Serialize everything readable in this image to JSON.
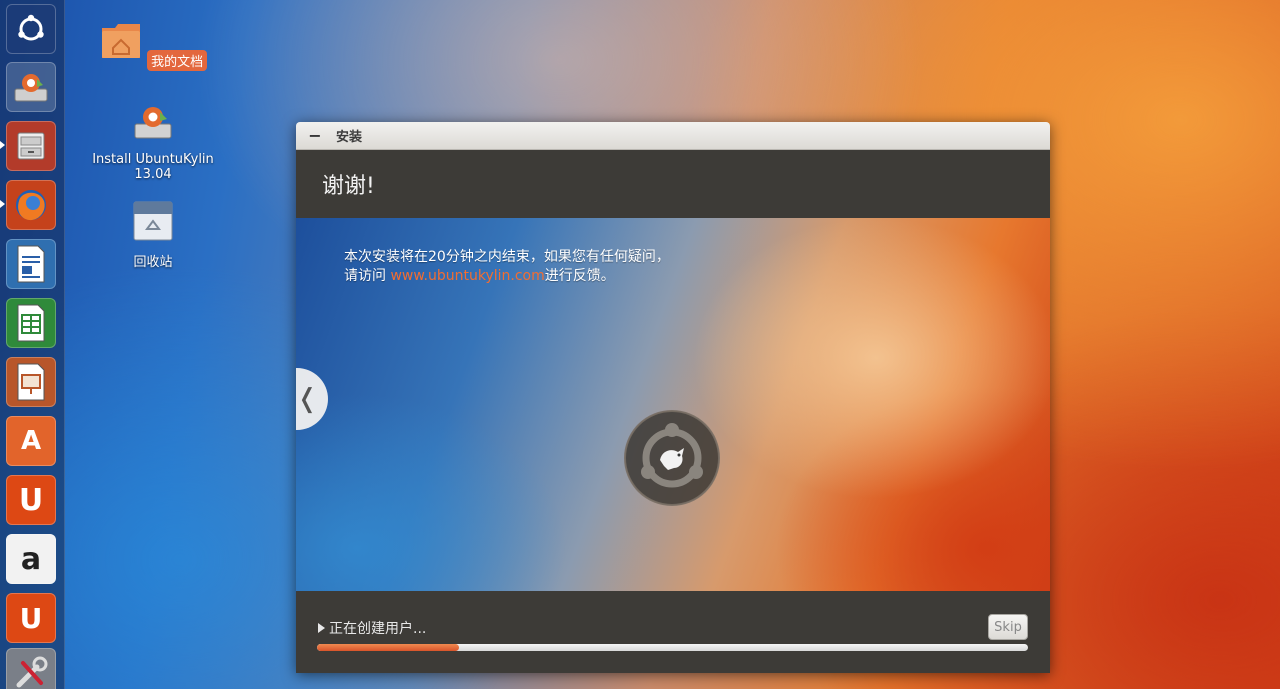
{
  "desktop": {
    "icons": [
      {
        "label": "我的文档",
        "icon": "folder-home-icon",
        "selected": true
      },
      {
        "label_line1": "Install UbuntuKylin",
        "label_line2": "13.04",
        "icon": "installer-icon"
      },
      {
        "label": "回收站",
        "icon": "trash-icon"
      }
    ]
  },
  "launcher": {
    "items": [
      {
        "name": "dash-home",
        "icon": "ubuntu-logo-icon"
      },
      {
        "name": "installer",
        "icon": "installer-icon"
      },
      {
        "name": "file-manager",
        "icon": "file-cabinet-icon",
        "running": true
      },
      {
        "name": "firefox",
        "icon": "firefox-icon",
        "running": true
      },
      {
        "name": "writer",
        "icon": "document-writer-icon"
      },
      {
        "name": "calc",
        "icon": "spreadsheet-icon"
      },
      {
        "name": "impress",
        "icon": "presentation-icon"
      },
      {
        "name": "software-center",
        "icon": "software-center-icon",
        "glyph": "A"
      },
      {
        "name": "ubuntu-one",
        "icon": "ubuntu-one-icon",
        "glyph": "U"
      },
      {
        "name": "amazon",
        "icon": "amazon-icon",
        "glyph": "a"
      },
      {
        "name": "ubuntu-one-music",
        "icon": "ubuntu-one-music-icon",
        "glyph": "U"
      },
      {
        "name": "system-settings",
        "icon": "settings-tools-icon"
      }
    ]
  },
  "installer_window": {
    "title": "安装",
    "heading": "谢谢!",
    "slide_text_before": "本次安装将在20分钟之内结束，如果您有任何疑问，请访问 ",
    "slide_link": "www.ubuntukylin.com",
    "slide_text_after": "进行反馈。",
    "status_text": "正在创建用户...",
    "skip_label": "Skip",
    "progress": 0.2
  },
  "colors": {
    "accent": "#e3673d",
    "dark_panel": "#3d3b37",
    "link": "#f26d31"
  }
}
